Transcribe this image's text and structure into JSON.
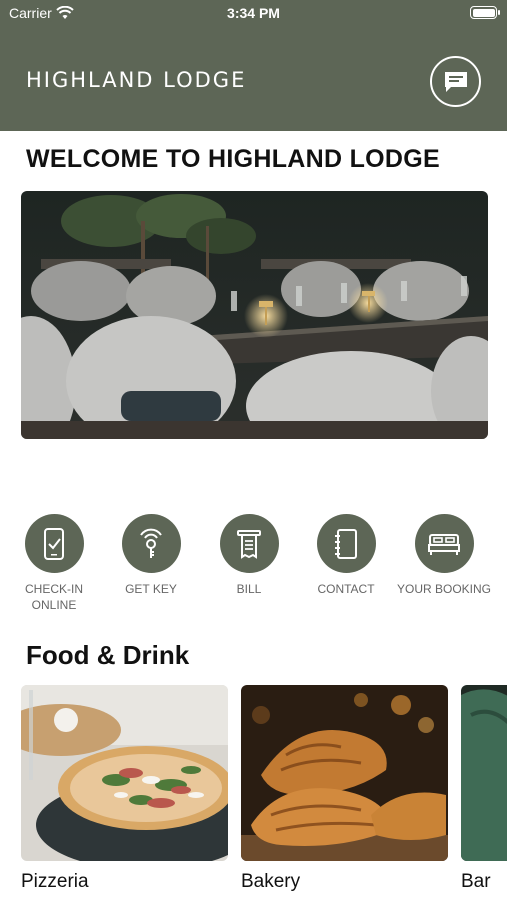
{
  "status_bar": {
    "carrier": "Carrier",
    "time": "3:34 PM"
  },
  "header": {
    "brand": "HIGHLAND LODGE",
    "chat_icon": "chat-icon"
  },
  "welcome": {
    "title": "WELCOME TO HIGHLAND LODGE",
    "hero_image": "restaurant-interior"
  },
  "actions": [
    {
      "label": "CHECK-IN ONLINE",
      "icon": "phone-check-icon"
    },
    {
      "label": "GET KEY",
      "icon": "key-icon"
    },
    {
      "label": "BILL",
      "icon": "receipt-icon"
    },
    {
      "label": "CONTACT",
      "icon": "notebook-icon"
    },
    {
      "label": "YOUR BOOKING",
      "icon": "bed-icon"
    }
  ],
  "food_drink": {
    "title": "Food & Drink",
    "cards": [
      {
        "label": "Pizzeria",
        "image": "pizza"
      },
      {
        "label": "Bakery",
        "image": "croissants"
      },
      {
        "label": "Bar",
        "image": "bar-seating"
      }
    ]
  },
  "colors": {
    "brand": "#5d6656",
    "text": "#111111",
    "muted": "#666666"
  }
}
